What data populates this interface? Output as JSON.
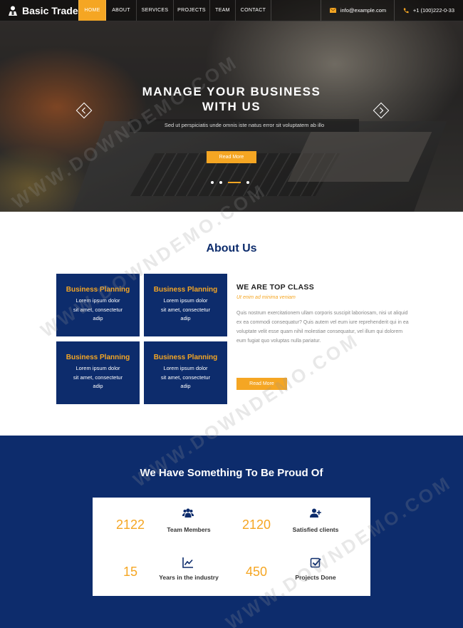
{
  "nav": {
    "brand": "Basic Trade",
    "items": [
      {
        "label": "HOME",
        "active": true
      },
      {
        "label": "ABOUT"
      },
      {
        "label": "SERVICES"
      },
      {
        "label": "PROJECTS"
      },
      {
        "label": "TEAM"
      },
      {
        "label": "CONTACT"
      }
    ],
    "email": "info@example.com",
    "phone": "+1 (100)222-0-33"
  },
  "hero": {
    "title_line1": "MANAGE YOUR BUSINESS",
    "title_line2": "WITH US",
    "subtitle": "Sed ut perspiciatis unde omnis iste natus error sit voluptatem ab illo",
    "button": "Read More"
  },
  "about": {
    "title": "About Us",
    "cards": [
      {
        "title": "Business Planning",
        "line1": "Lorem ipsum dolor",
        "line2": "sit amet, consectetur",
        "line3": "adip"
      },
      {
        "title": "Business Planning",
        "line1": "Lorem ipsum dolor",
        "line2": "sit amet, consectetur",
        "line3": "adip"
      },
      {
        "title": "Business Planning",
        "line1": "Lorem ipsum dolor",
        "line2": "sit amet, consectetur",
        "line3": "adip"
      },
      {
        "title": "Business Planning",
        "line1": "Lorem ipsum dolor",
        "line2": "sit amet, consectetur",
        "line3": "adip"
      }
    ],
    "heading": "WE ARE TOP CLASS",
    "tagline": "Ut enim ad minima veniam",
    "body": "Quis nostrum exercitationem ullam corporis suscipit laboriosam, nisi ut aliquid ex ea commodi consequatur? Quis autem vel eum iure reprehenderit qui in ea voluptate velit esse quam nihil molestiae consequatur, vel illum qui dolorem eum fugiat quo voluptas nulla pariatur.",
    "button": "Read More"
  },
  "proud": {
    "title": "We Have Something To Be Proud Of",
    "stats": [
      {
        "number": "2122",
        "label": "Team Members",
        "icon": "users-icon"
      },
      {
        "number": "2120",
        "label": "Satisfied clients",
        "icon": "user-plus-icon"
      },
      {
        "number": "15",
        "label": "Years in the industry",
        "icon": "chart-line-icon"
      },
      {
        "number": "450",
        "label": "Projects Done",
        "icon": "check-square-icon"
      }
    ]
  },
  "watermark": "WWW.DOWNDEMO.COM",
  "colors": {
    "accent": "#f5a623",
    "navy": "#0d2c6c"
  }
}
